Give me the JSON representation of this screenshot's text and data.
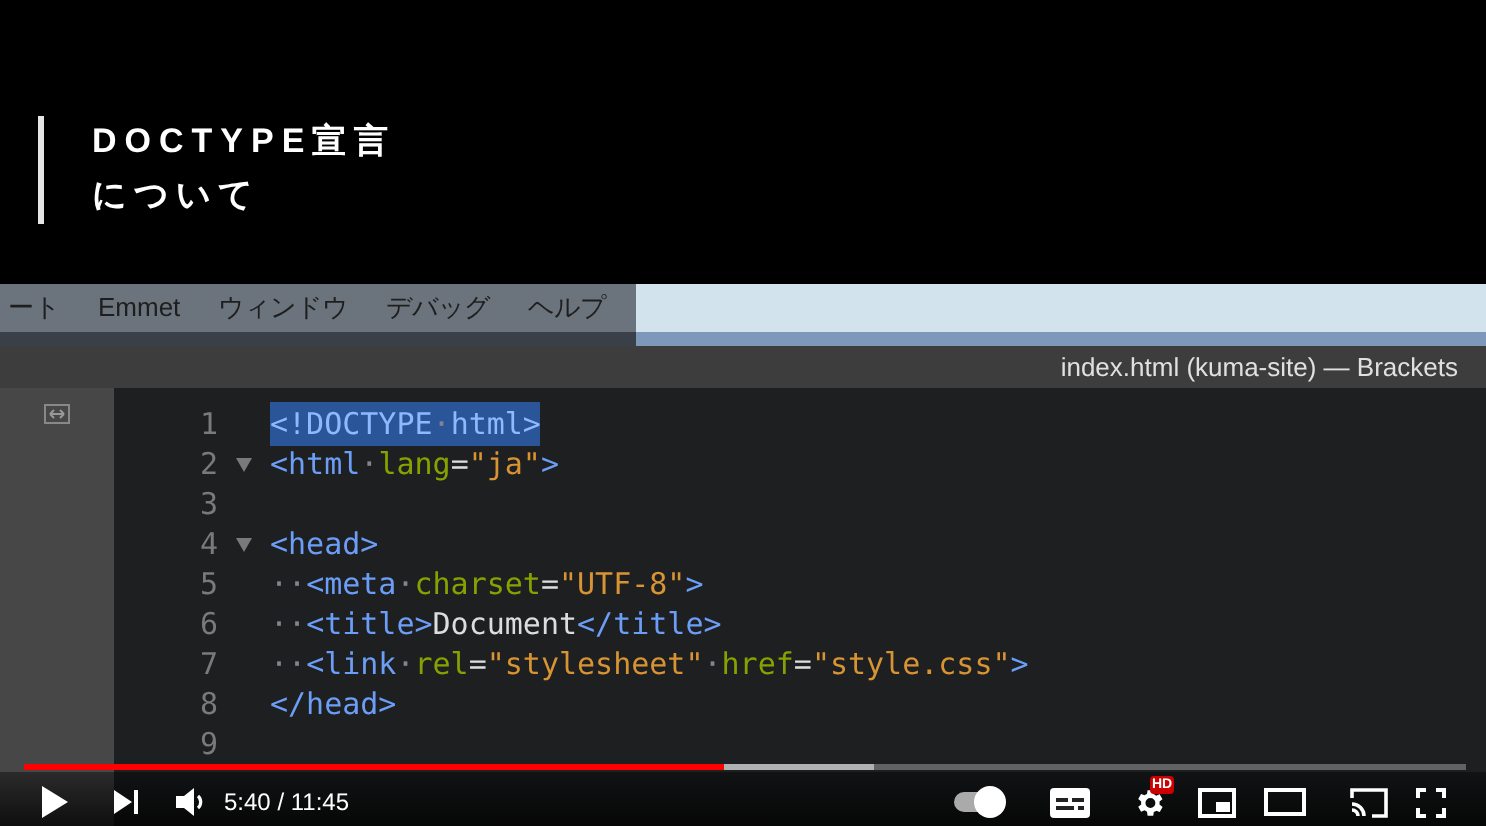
{
  "video_title_card": {
    "lines": [
      "DOCTYPE宣言",
      "について"
    ]
  },
  "editor_window": {
    "menu": [
      "ート",
      "Emmet",
      "ウィンドウ",
      "デバッグ",
      "ヘルプ"
    ],
    "title": "index.html (kuma-site) — Brackets",
    "lines": [
      {
        "number": "1",
        "foldable": false,
        "selected": true,
        "tokens": [
          {
            "kind": "tag",
            "text": "<!DOCTYPE"
          },
          {
            "kind": "ws",
            "text": "·"
          },
          {
            "kind": "tag",
            "text": "html>"
          }
        ]
      },
      {
        "number": "2",
        "foldable": true,
        "selected": false,
        "tokens": [
          {
            "kind": "tag",
            "text": "<html"
          },
          {
            "kind": "ws",
            "text": "·"
          },
          {
            "kind": "attr",
            "text": "lang"
          },
          {
            "kind": "text",
            "text": "="
          },
          {
            "kind": "string",
            "text": "\"ja\""
          },
          {
            "kind": "tag",
            "text": ">"
          }
        ]
      },
      {
        "number": "3",
        "foldable": false,
        "selected": false
      },
      {
        "number": "4",
        "foldable": true,
        "selected": false,
        "tokens": [
          {
            "kind": "tag",
            "text": "<head>"
          }
        ]
      },
      {
        "number": "5",
        "foldable": false,
        "selected": false,
        "tokens": [
          {
            "kind": "ws",
            "text": "··"
          },
          {
            "kind": "tag",
            "text": "<meta"
          },
          {
            "kind": "ws",
            "text": "·"
          },
          {
            "kind": "attr",
            "text": "charset"
          },
          {
            "kind": "text",
            "text": "="
          },
          {
            "kind": "string",
            "text": "\"UTF-8\""
          },
          {
            "kind": "tag",
            "text": ">"
          }
        ]
      },
      {
        "number": "6",
        "foldable": false,
        "selected": false,
        "tokens": [
          {
            "kind": "ws",
            "text": "··"
          },
          {
            "kind": "tag",
            "text": "<title>"
          },
          {
            "kind": "text",
            "text": "Document"
          },
          {
            "kind": "tag",
            "text": "</title>"
          }
        ]
      },
      {
        "number": "7",
        "foldable": false,
        "selected": false,
        "tokens": [
          {
            "kind": "ws",
            "text": "··"
          },
          {
            "kind": "tag",
            "text": "<link"
          },
          {
            "kind": "ws",
            "text": "·"
          },
          {
            "kind": "attr",
            "text": "rel"
          },
          {
            "kind": "text",
            "text": "="
          },
          {
            "kind": "string",
            "text": "\"stylesheet\""
          },
          {
            "kind": "ws",
            "text": "·"
          },
          {
            "kind": "attr",
            "text": "href"
          },
          {
            "kind": "text",
            "text": "="
          },
          {
            "kind": "string",
            "text": "\"style.css\""
          },
          {
            "kind": "tag",
            "text": ">"
          }
        ]
      },
      {
        "number": "8",
        "foldable": false,
        "selected": false,
        "tokens": [
          {
            "kind": "tag",
            "text": "</head>"
          }
        ]
      },
      {
        "number": "9",
        "foldable": false,
        "selected": false
      }
    ]
  },
  "player": {
    "played": {
      "level": 0.485
    },
    "buffered": {
      "level": 0.59
    },
    "time": "5:40 / 11:45",
    "autoplay": true,
    "settings_badge": "HD"
  }
}
